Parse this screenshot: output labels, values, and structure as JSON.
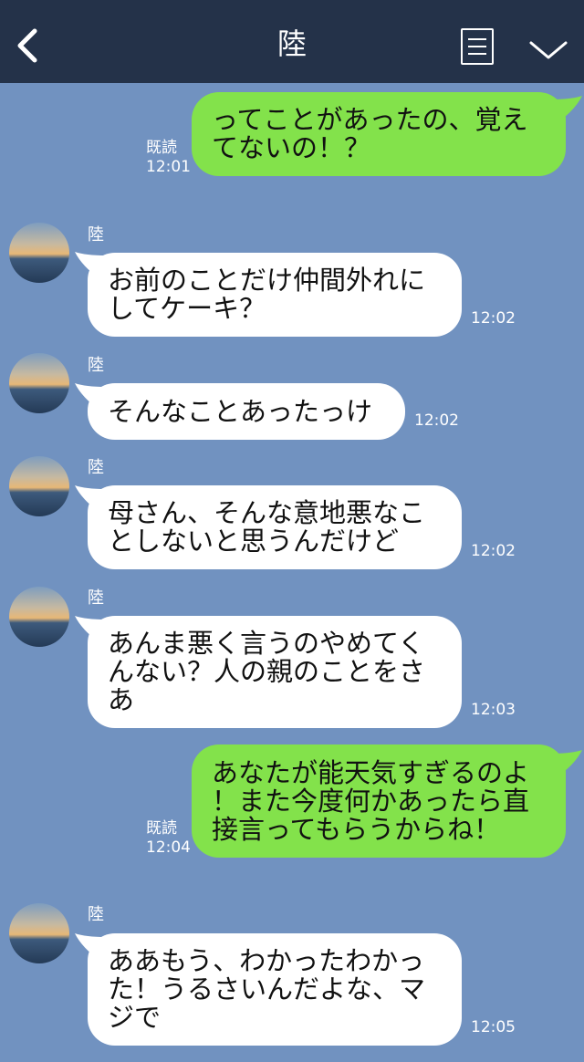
{
  "header": {
    "title": "陸"
  },
  "messages": [
    {
      "id": "m1",
      "direction": "out",
      "text": "ってことがあったの、覚え\nてないの！？",
      "read_label": "既読",
      "time": "12:01"
    },
    {
      "id": "m2",
      "direction": "in",
      "sender": "陸",
      "text": "お前のことだけ仲間外れに\nしてケーキ？",
      "time": "12:02"
    },
    {
      "id": "m3",
      "direction": "in",
      "sender": "陸",
      "text": "そんなことあったっけ",
      "time": "12:02"
    },
    {
      "id": "m4",
      "direction": "in",
      "sender": "陸",
      "text": "母さん、そんな意地悪なこ\nとしないと思うんだけど",
      "time": "12:02"
    },
    {
      "id": "m5",
      "direction": "in",
      "sender": "陸",
      "text": "あんま悪く言うのやめてく\nんない？人の親のことをさ\nあ",
      "time": "12:03"
    },
    {
      "id": "m6",
      "direction": "out",
      "text": "あなたが能天気すぎるのよ\n！また今度何かあったら直\n接言ってもらうからね！",
      "read_label": "既読",
      "time": "12:04"
    },
    {
      "id": "m7",
      "direction": "in",
      "sender": "陸",
      "text": "ああもう、わかったわかっ\nた！うるさいんだよな、マ\nジで",
      "time": "12:05"
    }
  ],
  "colors": {
    "header_bg": "#243249",
    "chat_bg": "#7192c0",
    "out_bubble": "#83e24b",
    "in_bubble": "#ffffff"
  },
  "icons": {
    "back": "chevron-left-icon",
    "note": "note-icon",
    "menu": "chevron-down-icon"
  }
}
